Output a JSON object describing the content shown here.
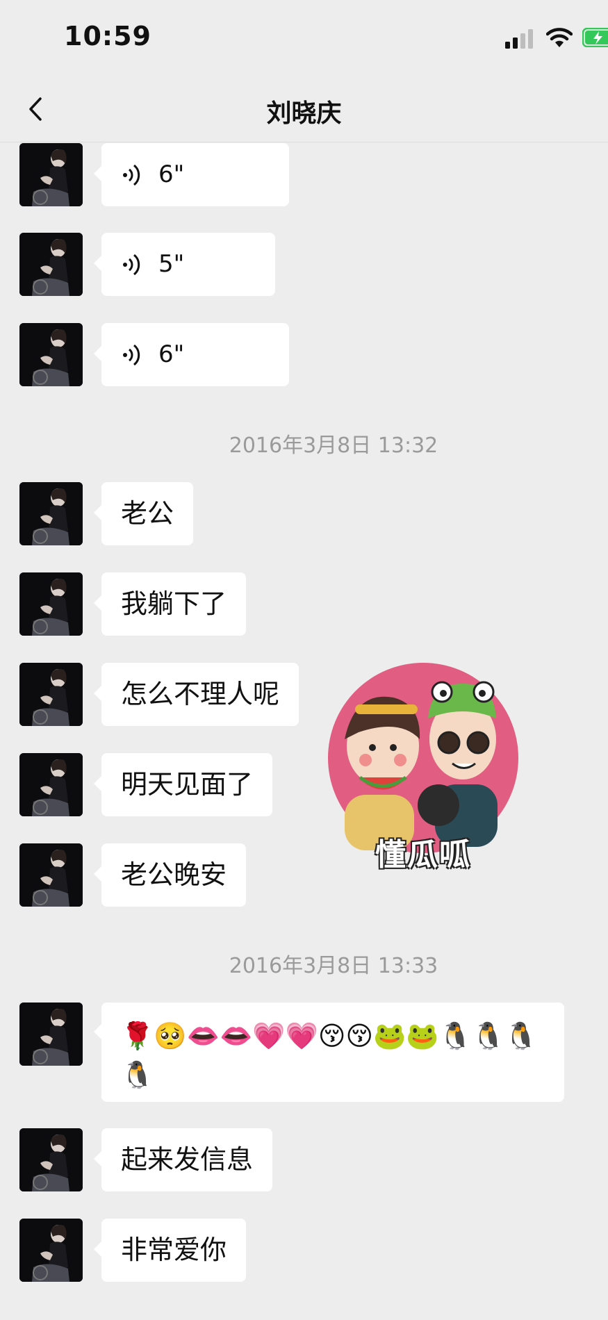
{
  "status_bar": {
    "time": "10:59"
  },
  "nav": {
    "title": "刘晓庆"
  },
  "messages_top": [
    {
      "kind": "voice",
      "duration": "6\""
    },
    {
      "kind": "voice",
      "duration": "5\""
    },
    {
      "kind": "voice",
      "duration": "6\""
    }
  ],
  "timestamps": [
    "2016年3月8日 13:32",
    "2016年3月8日 13:33"
  ],
  "texts": [
    "老公",
    "我躺下了",
    "怎么不理人呢",
    "明天见面了",
    "老公晚安",
    "起来发信息",
    "非常爱你"
  ],
  "emoji_message": "🌹🥺👄👄💗💗😚😚🐸🐸🐧🐧🐧🐧",
  "watermark": {
    "label": "懂瓜呱"
  },
  "colors": {
    "background": "#ededed",
    "bubble": "#ffffff",
    "timestamp": "#9a9a9a",
    "battery": "#34c759"
  }
}
